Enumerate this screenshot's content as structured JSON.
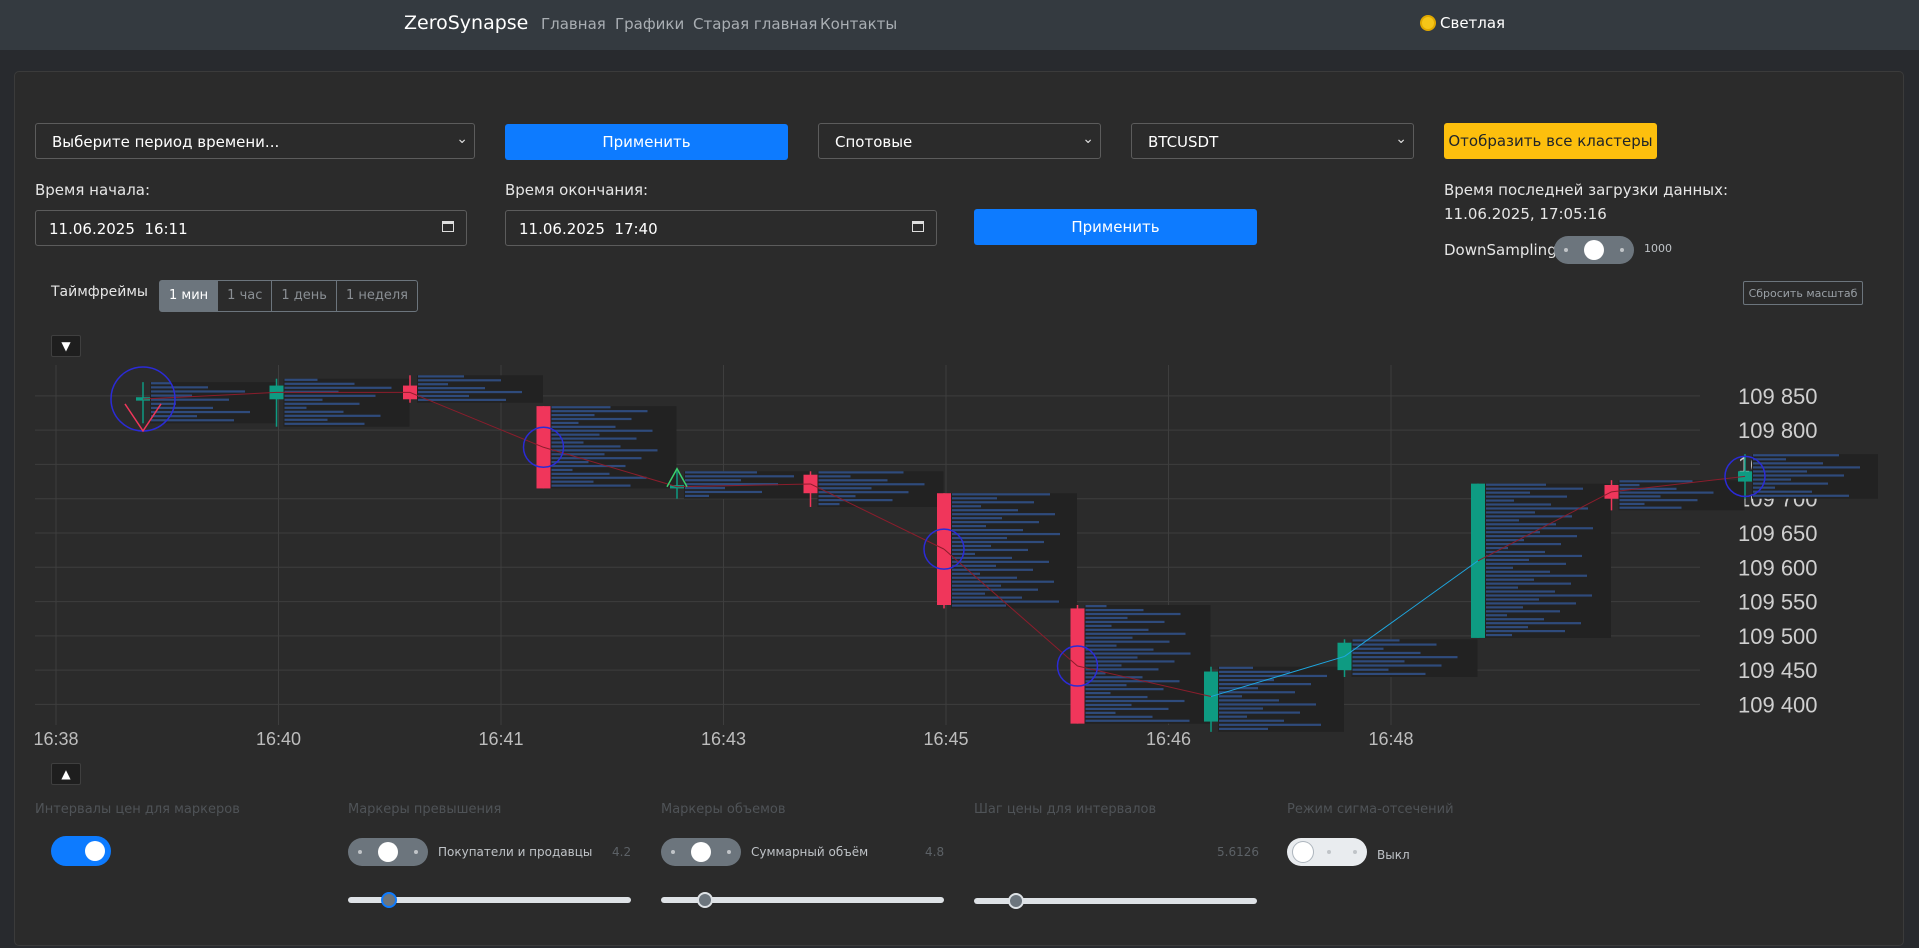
{
  "nav": {
    "brand": "ZeroSynapse",
    "links": [
      "Главная",
      "Графики",
      "Старая главная",
      "Контакты"
    ],
    "theme_label": "Светлая"
  },
  "controls": {
    "period_select": "Выберите период времени...",
    "apply_label": "Применить",
    "market_select": "Спотовые",
    "symbol_select": "BTCUSDT",
    "show_clusters": "Отобразить все кластеры",
    "start_label": "Время начала:",
    "start_value": "11.06.2025  16:11",
    "end_label": "Время окончания:",
    "end_value": "11.06.2025  17:40",
    "last_load_label": "Время последней загрузки данных:",
    "last_load_value": "11.06.2025, 17:05:16",
    "downsampling_label": "DownSampling:",
    "downsampling_value": "1000"
  },
  "timeframes": {
    "label": "Таймфреймы",
    "options": [
      "1 мин",
      "1 час",
      "1 день",
      "1 неделя"
    ],
    "active": "1 мин"
  },
  "reset_zoom": "Сбросить масштаб",
  "chart_data": {
    "type": "candlestick",
    "x_ticks": [
      "16:38",
      "16:40",
      "16:41",
      "16:43",
      "16:45",
      "16:46",
      "16:48"
    ],
    "y_ticks": [
      "109 850",
      "109 800",
      "109 750",
      "109 700",
      "109 650",
      "109 600",
      "109 550",
      "109 500",
      "109 450",
      "109 400"
    ],
    "ylim": [
      109370,
      109895
    ],
    "grid": true,
    "candles": [
      {
        "i": 0,
        "open": 109843,
        "close": 109848,
        "high": 109870,
        "low": 109810,
        "dir": "up"
      },
      {
        "i": 1,
        "open": 109845,
        "close": 109865,
        "high": 109875,
        "low": 109805,
        "dir": "up"
      },
      {
        "i": 2,
        "open": 109865,
        "close": 109845,
        "high": 109880,
        "low": 109840,
        "dir": "down"
      },
      {
        "i": 3,
        "open": 109835,
        "close": 109715,
        "high": 109835,
        "low": 109715,
        "dir": "down"
      },
      {
        "i": 4,
        "open": 109715,
        "close": 109720,
        "high": 109740,
        "low": 109700,
        "dir": "up"
      },
      {
        "i": 5,
        "open": 109735,
        "close": 109708,
        "high": 109740,
        "low": 109688,
        "dir": "down"
      },
      {
        "i": 6,
        "open": 109708,
        "close": 109545,
        "high": 109708,
        "low": 109540,
        "dir": "down"
      },
      {
        "i": 7,
        "open": 109540,
        "close": 109372,
        "high": 109545,
        "low": 109372,
        "dir": "down"
      },
      {
        "i": 8,
        "open": 109375,
        "close": 109448,
        "high": 109455,
        "low": 109360,
        "dir": "up"
      },
      {
        "i": 9,
        "open": 109450,
        "close": 109490,
        "high": 109495,
        "low": 109440,
        "dir": "up"
      },
      {
        "i": 10,
        "open": 109497,
        "close": 109722,
        "high": 109722,
        "low": 109497,
        "dir": "up"
      },
      {
        "i": 11,
        "open": 109720,
        "close": 109700,
        "high": 109727,
        "low": 109683,
        "dir": "down"
      },
      {
        "i": 12,
        "open": 109725,
        "close": 109740,
        "high": 109765,
        "low": 109700,
        "dir": "up"
      }
    ]
  },
  "bottom": {
    "price_intervals_title": "Интервалы цен для маркеров",
    "excess_title": "Маркеры превышения",
    "excess_switch_label": "Покупатели и продавцы",
    "excess_value": "4.2",
    "volume_title": "Маркеры объемов",
    "volume_switch_label": "Суммарный объём",
    "volume_value": "4.8",
    "price_step_title": "Шаг цены для интервалов",
    "price_step_value": "5.6126",
    "sigma_title": "Режим сигма-отсечений",
    "sigma_switch_label": "Выкл"
  },
  "colors": {
    "up": "#0e9b82",
    "down": "#f0365b",
    "profile": "#2f4b7c",
    "accent": "#0d7bff",
    "warning": "#fdbf0d"
  }
}
